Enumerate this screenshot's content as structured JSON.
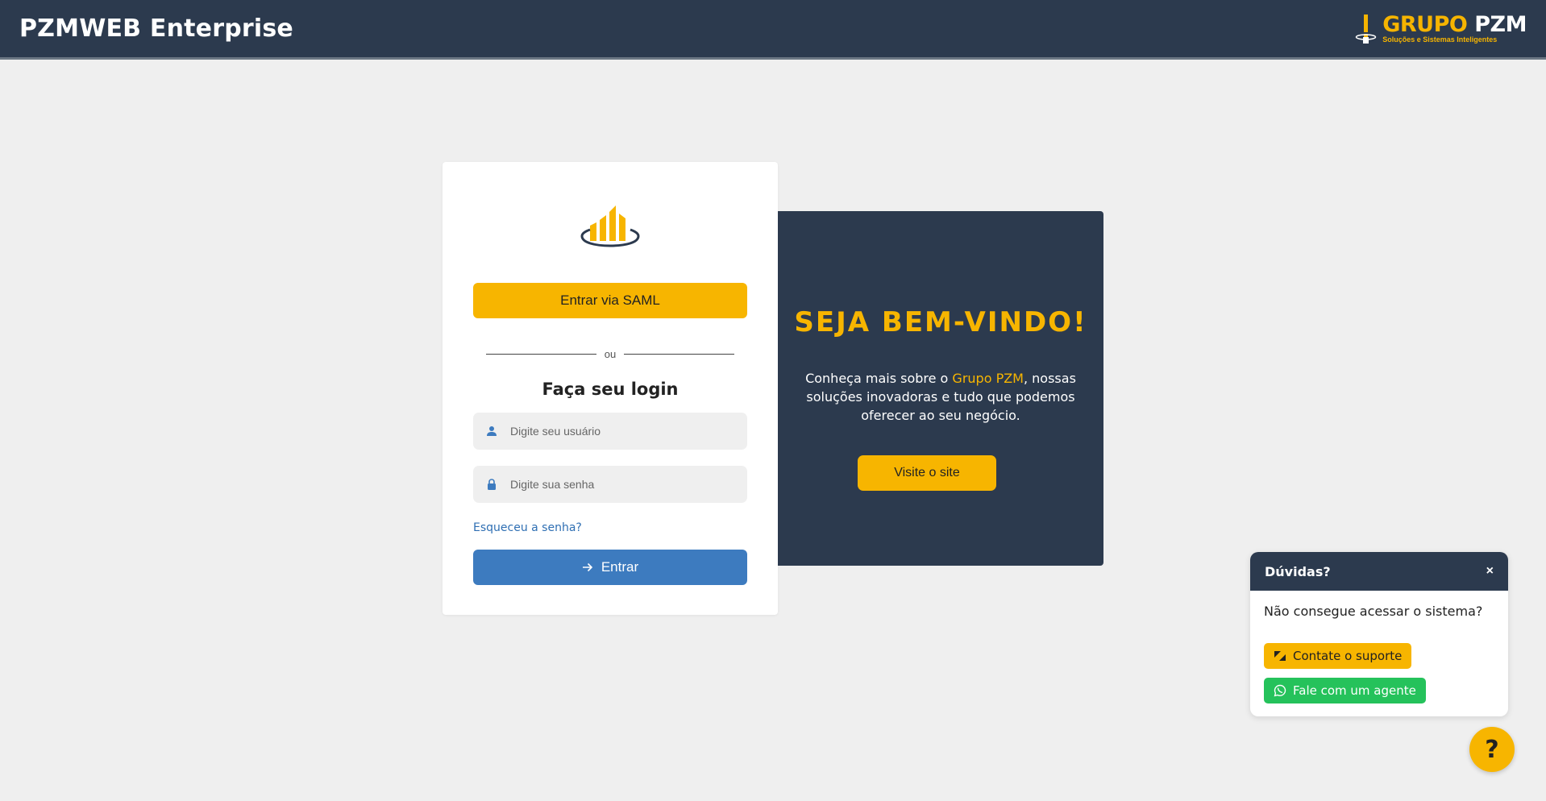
{
  "header": {
    "app_title": "PZMWEB Enterprise",
    "brand_name_part1": "GRUPO",
    "brand_name_part2": "PZM",
    "brand_tagline": "Soluções e Sistemas Inteligentes"
  },
  "login": {
    "saml_button": "Entrar via SAML",
    "divider_text": "ou",
    "title": "Faça seu login",
    "username_placeholder": "Digite seu usuário",
    "password_placeholder": "Digite sua senha",
    "forgot_link": "Esqueceu a senha?",
    "submit_button": "Entrar"
  },
  "welcome": {
    "title": "SEJA BEM-VINDO!",
    "text_before": "Conheça mais sobre o ",
    "text_highlight": "Grupo PZM",
    "text_after": ", nossas soluções inovadoras e tudo que podemos oferecer ao seu negócio.",
    "visit_button": "Visite o site"
  },
  "help": {
    "title": "Dúvidas?",
    "close": "×",
    "question": "Não consegue acessar o sistema?",
    "support_button": "Contate o suporte",
    "agent_button": "Fale com um agente",
    "fab_label": "?"
  },
  "colors": {
    "header_bg": "#2c3a4e",
    "accent": "#f7b500",
    "primary": "#3d7bbf",
    "whatsapp": "#25c25b",
    "page_bg": "#efefef"
  },
  "icons": {
    "logo": "bar-chart-logo-icon",
    "user": "user-icon",
    "lock": "lock-icon",
    "arrow": "arrow-right-icon",
    "zendesk": "zendesk-icon",
    "whatsapp": "whatsapp-icon"
  }
}
